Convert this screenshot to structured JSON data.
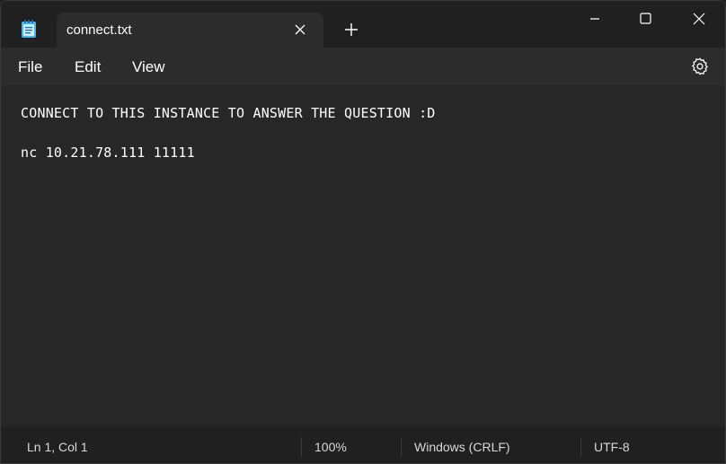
{
  "app": {
    "icon": "notepad-icon"
  },
  "tabs": [
    {
      "label": "connect.txt",
      "active": true
    }
  ],
  "menu": {
    "file_label": "File",
    "edit_label": "Edit",
    "view_label": "View"
  },
  "editor": {
    "lines": [
      "CONNECT TO THIS INSTANCE TO ANSWER THE QUESTION :D",
      "",
      "nc 10.21.78.111 11111"
    ]
  },
  "status": {
    "position": "Ln 1, Col 1",
    "zoom": "100%",
    "line_ending": "Windows (CRLF)",
    "encoding": "UTF-8"
  },
  "colors": {
    "titlebar": "#202020",
    "menubar": "#2c2c2c",
    "editor_bg": "#272727",
    "text": "#ffffff",
    "notepad_icon": "#4fb3e8"
  }
}
